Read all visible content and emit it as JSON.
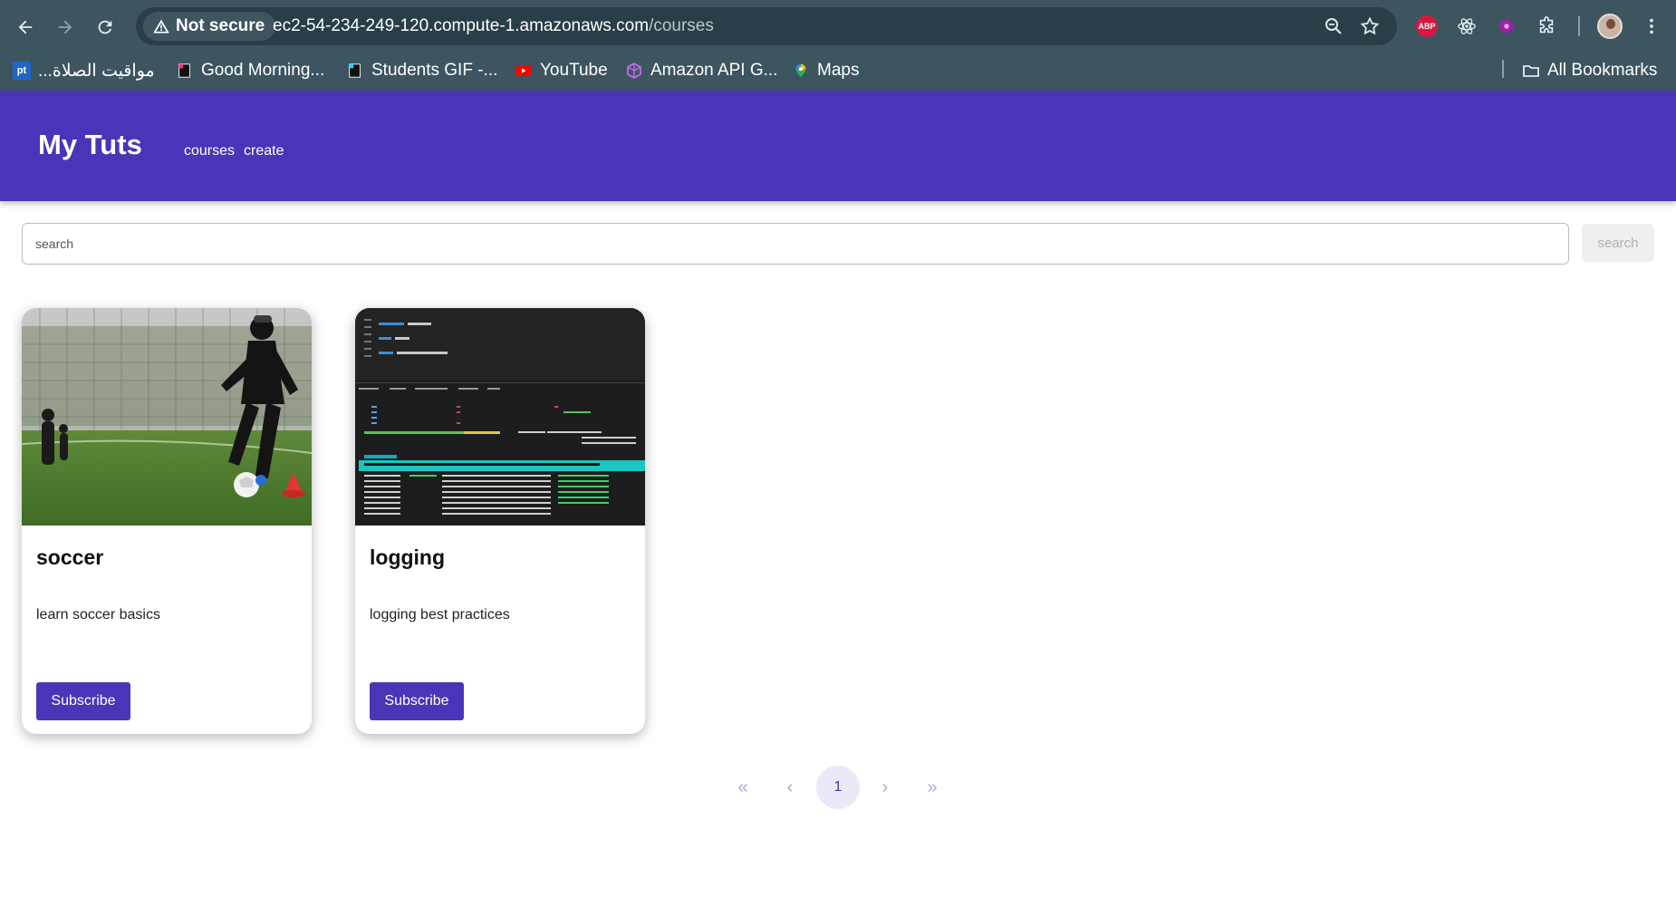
{
  "browser": {
    "security_label": "Not secure",
    "url_host": "ec2-54-234-249-120.compute-1.amazonaws.com",
    "url_path": "/courses",
    "extension_abp": "ABP",
    "bookmarks": [
      {
        "label": "مواقيت الصلاة...",
        "icon": "pt"
      },
      {
        "label": "Good Morning...",
        "icon": "bookmark-page-icon"
      },
      {
        "label": "Students GIF -...",
        "icon": "bookmark-page-icon"
      },
      {
        "label": "YouTube",
        "icon": "youtube-icon"
      },
      {
        "label": "Amazon API G...",
        "icon": "api-gateway-icon"
      },
      {
        "label": "Maps",
        "icon": "maps-icon"
      }
    ],
    "all_bookmarks": "All Bookmarks"
  },
  "app": {
    "brand": "My Tuts",
    "nav": [
      "courses",
      "create"
    ],
    "accent_color": "#4a35b8"
  },
  "search": {
    "placeholder": "search",
    "value": "",
    "button_label": "search"
  },
  "courses": [
    {
      "title": "soccer",
      "description": "learn soccer basics",
      "button": "Subscribe",
      "image": "soccer-player-photo"
    },
    {
      "title": "logging",
      "description": "logging best practices",
      "button": "Subscribe",
      "image": "terminal-htop-screenshot"
    }
  ],
  "pagination": {
    "first": "«",
    "prev": "‹",
    "current": "1",
    "next": "›",
    "last": "»"
  }
}
